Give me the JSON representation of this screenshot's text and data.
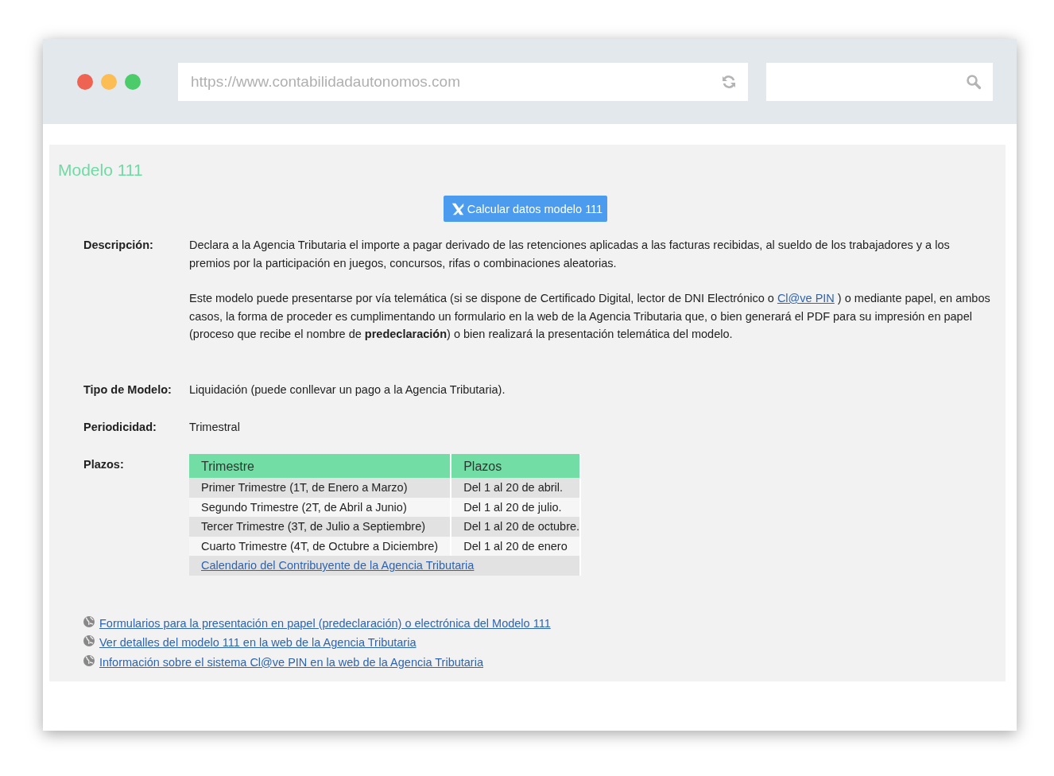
{
  "browser": {
    "address": "https://www.contabilidadautonomos.com",
    "traffic_lights": [
      {
        "color": "#ee6352"
      },
      {
        "color": "#fbbd54"
      },
      {
        "color": "#4ccb6b"
      }
    ]
  },
  "page": {
    "title": "Modelo 111",
    "calc_button": "Calcular datos modelo 111",
    "fields": [
      {
        "kind": "description",
        "label": "Descripción:",
        "paragraphs": [
          {
            "before": "Declara a la Agencia Tributaria el importe a pagar derivado de las retenciones aplicadas a las facturas recibidas, al sueldo de los trabajadores y a los premios por la participación en juegos, concursos, rifas o combinaciones aleatorias."
          },
          {
            "before": "Este modelo puede presentarse por vía telemática (si se dispone de Certificado Digital, lector de DNI Electrónico o ",
            "link": "Cl@ve PIN",
            "after": " ) o mediante papel, en ambos casos, la forma de proceder es cumplimentando un formulario en la web de la Agencia Tributaria que, o bien generará el PDF para su impresión en papel (proceso que recibe el nombre de **predeclaración**) o bien realizará la presentación telemática del modelo."
          }
        ]
      },
      {
        "kind": "text",
        "label": "Tipo de Modelo:",
        "value": "Liquidación (puede conllevar un pago a la Agencia Tributaria)."
      },
      {
        "kind": "text",
        "label": "Periodicidad:",
        "value": "Trimestral"
      },
      {
        "kind": "table",
        "label": "Plazos:",
        "columns": [
          "Trimestre",
          "Plazos"
        ],
        "rows": [
          [
            "Primer Trimestre (1T, de Enero a Marzo)",
            "Del 1 al 20 de abril."
          ],
          [
            "Segundo Trimestre (2T, de Abril a Junio)",
            "Del 1 al 20 de julio."
          ],
          [
            "Tercer Trimestre (3T, de Julio a Septiembre)",
            "Del 1 al 20 de octubre."
          ],
          [
            "Cuarto Trimestre (4T, de Octubre a Diciembre)",
            "Del 1 al 20 de enero"
          ]
        ],
        "footer_link": "Calendario del Contribuyente de la Agencia Tributaria"
      }
    ],
    "links": [
      "Formularios para la presentación en papel (predeclaración) o electrónica del Modelo 111",
      "Ver detalles del modelo 111 en la web de la Agencia Tributaria",
      "Información sobre el sistema Cl@ve PIN en la web de la Agencia Tributaria"
    ]
  }
}
